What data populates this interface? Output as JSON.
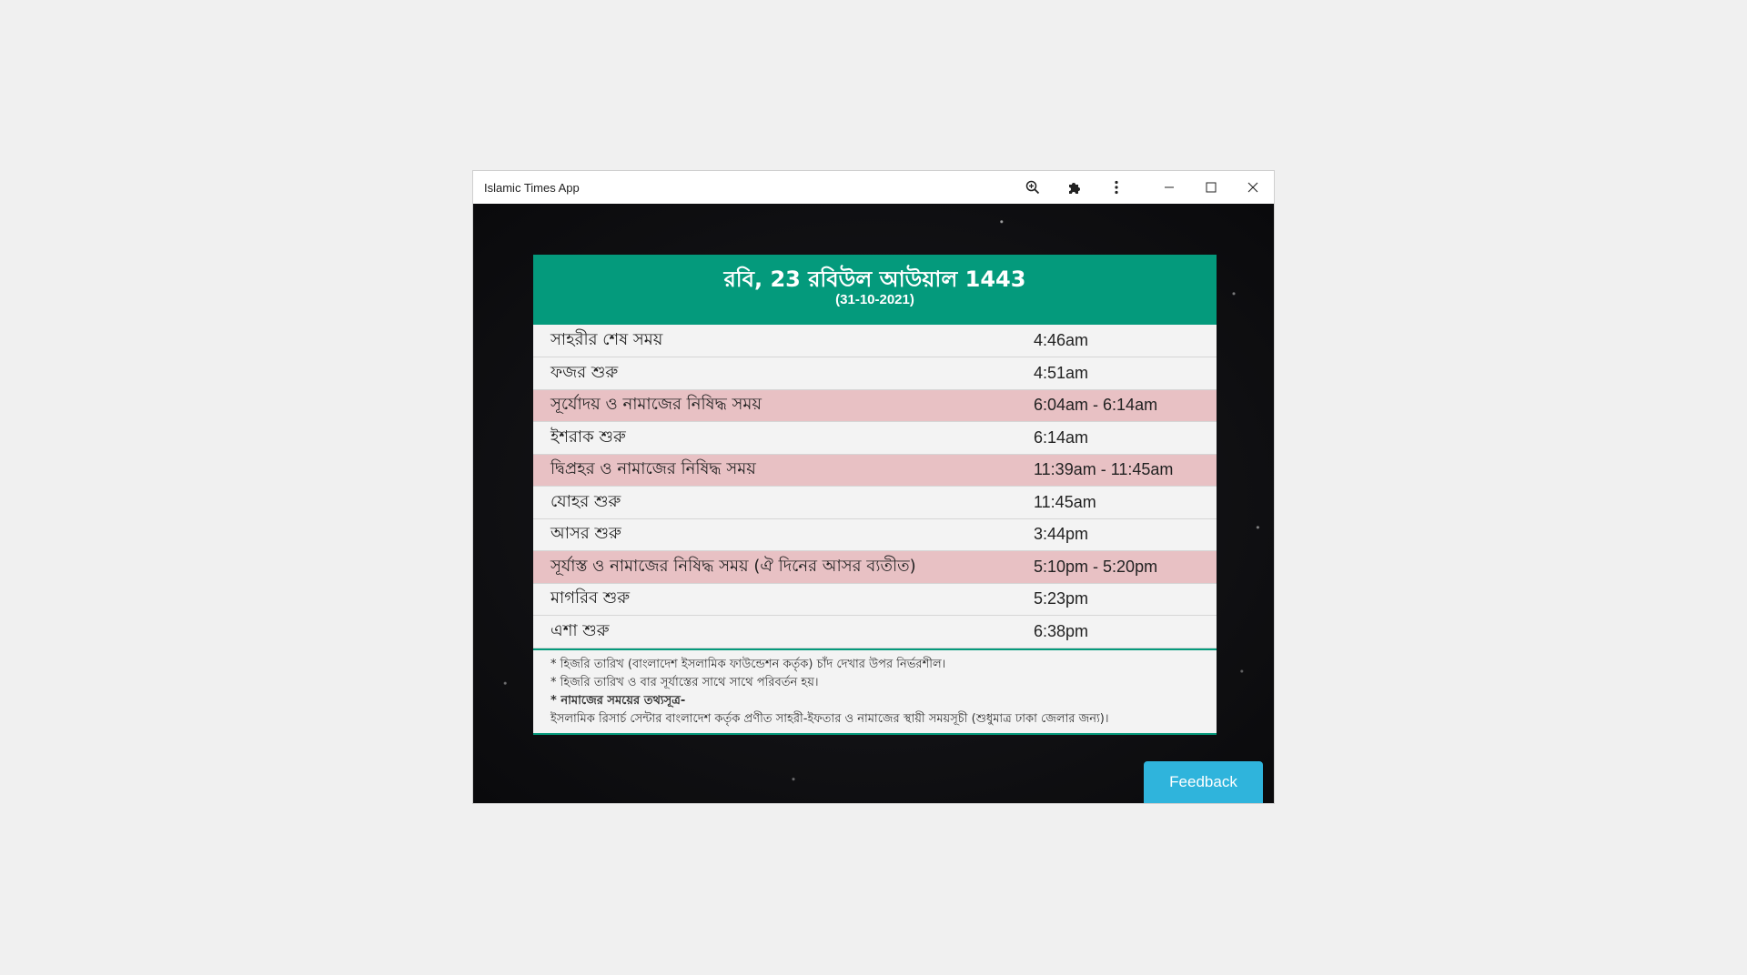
{
  "window": {
    "title": "Islamic Times App"
  },
  "titlebar_icons": [
    "zoom-in-icon",
    "puzzle-icon",
    "more-vert-icon",
    "minimize-icon",
    "maximize-icon",
    "close-icon"
  ],
  "header": {
    "hijri_date": "রবি, 23 রবিউল আউয়াল 1443",
    "gregorian_date": "(31-10-2021)"
  },
  "times": [
    {
      "label": "সাহরীর শেষ সময়",
      "time": "4:46am",
      "forbidden": false
    },
    {
      "label": "ফজর শুরু",
      "time": "4:51am",
      "forbidden": false
    },
    {
      "label": "সূর্যোদয় ও নামাজের নিষিদ্ধ সময়",
      "time": "6:04am - 6:14am",
      "forbidden": true
    },
    {
      "label": "ইশরাক শুরু",
      "time": "6:14am",
      "forbidden": false
    },
    {
      "label": "দ্বিপ্রহর ও নামাজের নিষিদ্ধ সময়",
      "time": "11:39am - 11:45am",
      "forbidden": true
    },
    {
      "label": "যোহর শুরু",
      "time": "11:45am",
      "forbidden": false
    },
    {
      "label": "আসর শুরু",
      "time": "3:44pm",
      "forbidden": false
    },
    {
      "label": "সূর্যাস্ত ও নামাজের নিষিদ্ধ সময় (ঐ দিনের আসর ব্যতীত)",
      "time": "5:10pm - 5:20pm",
      "forbidden": true
    },
    {
      "label": "মাগরিব শুরু",
      "time": "5:23pm",
      "forbidden": false
    },
    {
      "label": "এশা শুরু",
      "time": "6:38pm",
      "forbidden": false
    }
  ],
  "notes": {
    "line1": "* হিজরি তারিখ (বাংলাদেশ ইসলামিক ফাউন্ডেশন কর্তৃক) চাঁদ দেখার উপর নির্ভরশীল।",
    "line2": "* হিজরি তারিখ ও বার সূর্যাস্তের সাথে সাথে পরিবর্তন হয়।",
    "line3": "* নামাজের সময়ের তথ্যসূত্র-",
    "line4": "ইসলামিক রিসার্চ সেন্টার বাংলাদেশ কর্তৃক প্রণীত সাহরী-ইফতার ও নামাজের স্থায়ী সময়সূচী (শুধুমাত্র ঢাকা জেলার জন্য)।"
  },
  "feedback_label": "Feedback",
  "colors": {
    "header_green": "#049a7c",
    "forbidden_row": "#e8c1c4",
    "row_bg": "#f3f3f3",
    "feedback_blue": "#2fb4dc"
  }
}
